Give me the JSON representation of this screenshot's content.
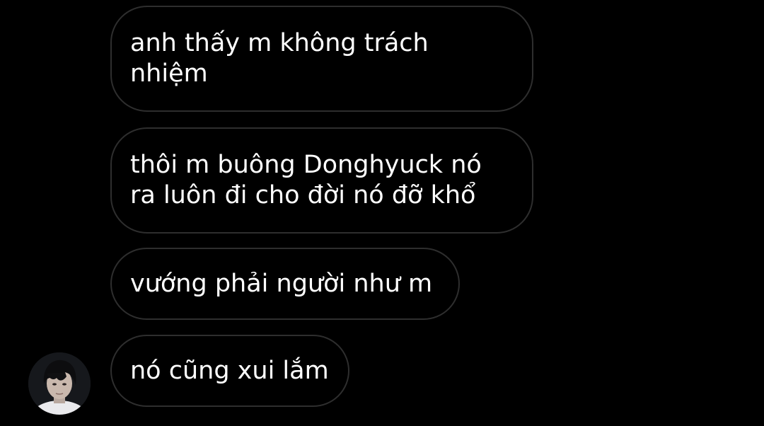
{
  "conversation": {
    "messages": [
      {
        "text": "anh thấy m không trách\nnhiệm"
      },
      {
        "text": "thôi m buông Donghyuck nó\nra luôn đi cho đời nó đỡ khổ"
      },
      {
        "text": "vướng phải người như m"
      },
      {
        "text": "nó cũng xui lắm"
      }
    ]
  },
  "colors": {
    "background": "#000000",
    "bubble_border": "#2e2e2e",
    "text": "#ffffff"
  }
}
